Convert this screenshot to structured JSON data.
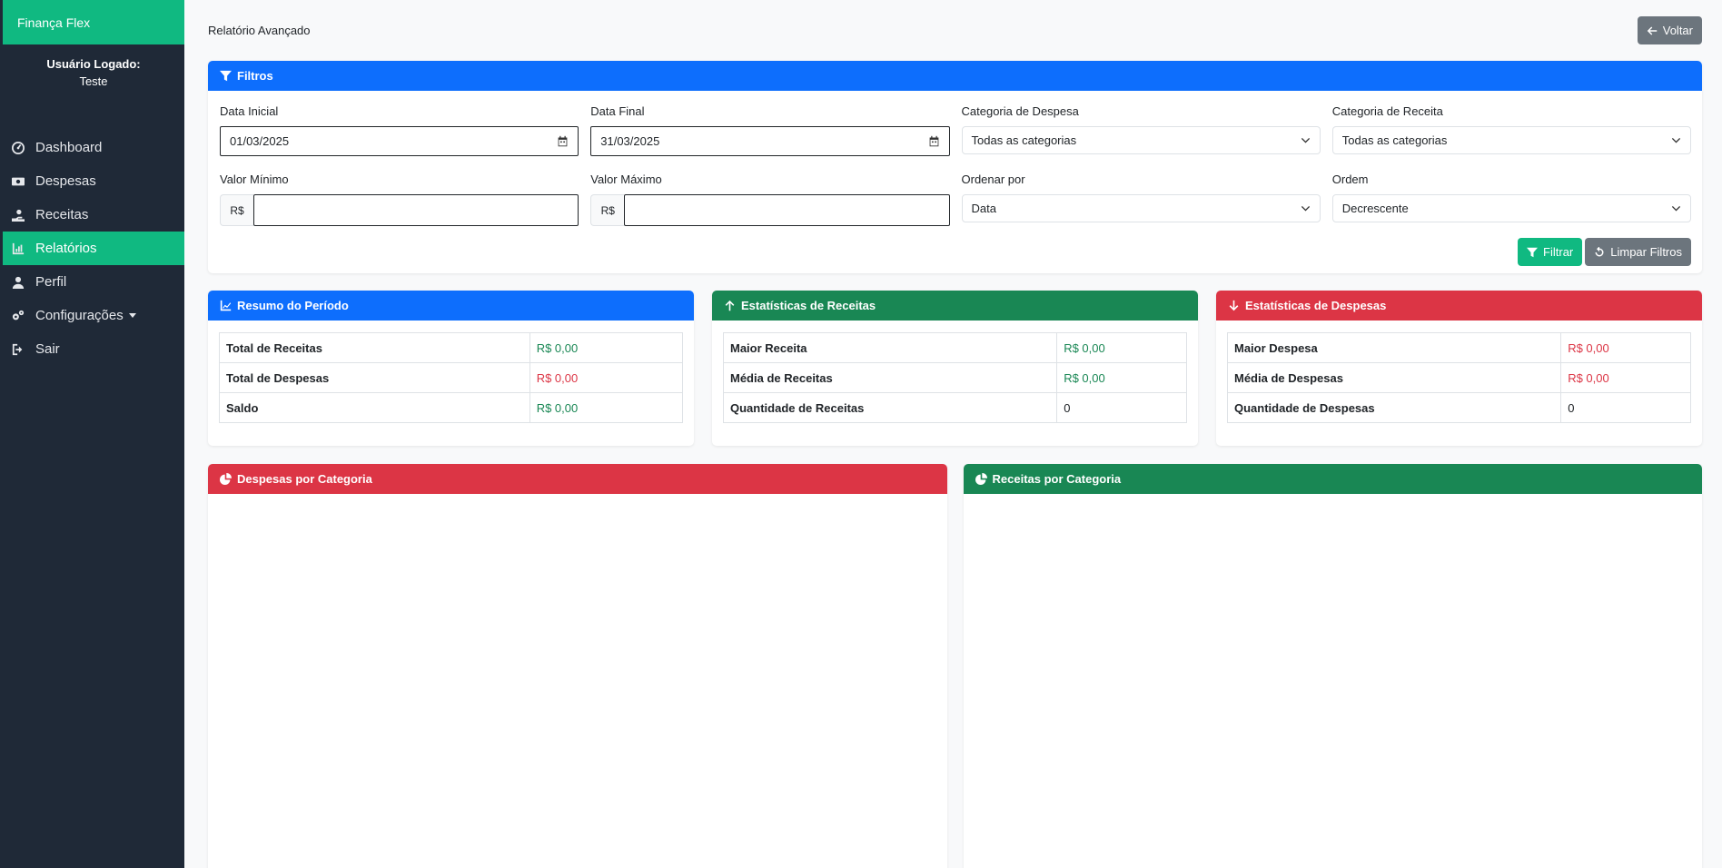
{
  "sidebar": {
    "brand": "Finança Flex",
    "user_label": "Usuário Logado:",
    "user_name": "Teste",
    "items": [
      {
        "label": "Dashboard",
        "icon": "dashboard-icon"
      },
      {
        "label": "Despesas",
        "icon": "money-bill-icon"
      },
      {
        "label": "Receitas",
        "icon": "hand-coin-icon"
      },
      {
        "label": "Relatórios",
        "icon": "chart-line-icon",
        "active": true
      },
      {
        "label": "Perfil",
        "icon": "user-icon"
      },
      {
        "label": "Configurações",
        "icon": "gears-icon",
        "dropdown": true
      },
      {
        "label": "Sair",
        "icon": "sign-out-icon"
      }
    ]
  },
  "header": {
    "title": "Relatório Avançado",
    "back_label": "Voltar"
  },
  "filters": {
    "title": "Filtros",
    "start_date_label": "Data Inicial",
    "start_date_value": "01/03/2025",
    "end_date_label": "Data Final",
    "end_date_value": "31/03/2025",
    "expense_category_label": "Categoria de Despesa",
    "expense_category_value": "Todas as categorias",
    "income_category_label": "Categoria de Receita",
    "income_category_value": "Todas as categorias",
    "min_value_label": "Valor Mínimo",
    "max_value_label": "Valor Máximo",
    "currency_prefix": "R$",
    "order_by_label": "Ordenar por",
    "order_by_value": "Data",
    "order_label": "Ordem",
    "order_value": "Decrescente",
    "filter_button": "Filtrar",
    "clear_button": "Limpar Filtros"
  },
  "summary": {
    "title": "Resumo do Período",
    "rows": [
      {
        "label": "Total de Receitas",
        "value": "R$ 0,00"
      },
      {
        "label": "Total de Despesas",
        "value": "R$ 0,00"
      },
      {
        "label": "Saldo",
        "value": "R$ 0,00"
      }
    ]
  },
  "income_stats": {
    "title": "Estatísticas de Receitas",
    "rows": [
      {
        "label": "Maior Receita",
        "value": "R$ 0,00"
      },
      {
        "label": "Média de Receitas",
        "value": "R$ 0,00"
      },
      {
        "label": "Quantidade de Receitas",
        "value": "0"
      }
    ]
  },
  "expense_stats": {
    "title": "Estatísticas de Despesas",
    "rows": [
      {
        "label": "Maior Despesa",
        "value": "R$ 0,00"
      },
      {
        "label": "Média de Despesas",
        "value": "R$ 0,00"
      },
      {
        "label": "Quantidade de Despesas",
        "value": "0"
      }
    ]
  },
  "charts": {
    "expenses_title": "Despesas por Categoria",
    "income_title": "Receitas por Categoria"
  },
  "colors": {
    "brand": "#10b981",
    "sidebar": "#1f2937",
    "primary": "#0d6efd",
    "success": "#198754",
    "danger": "#dc3545"
  }
}
